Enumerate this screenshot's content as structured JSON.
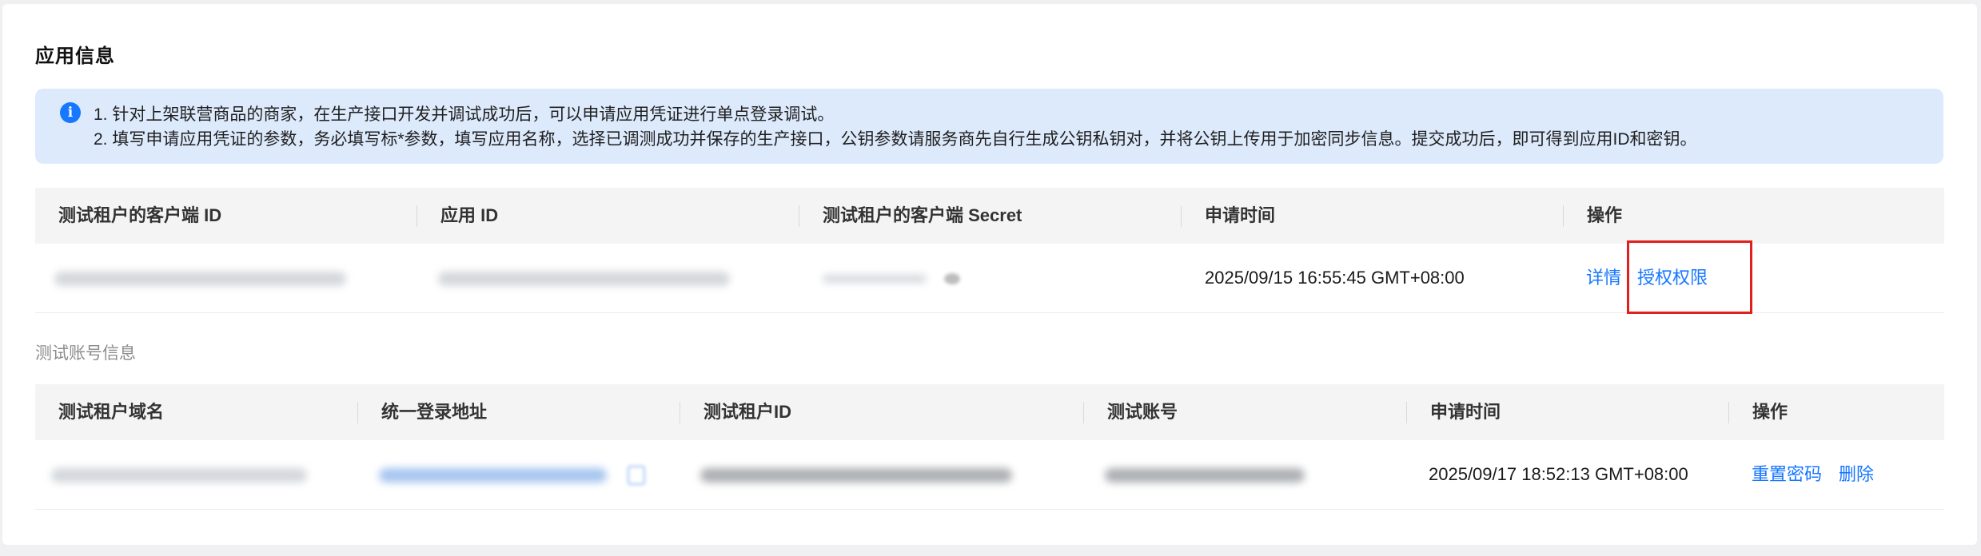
{
  "app_info": {
    "title": "应用信息",
    "notice": {
      "icon": "info-icon",
      "line1": "1. 针对上架联营商品的商家，在生产接口开发并调试成功后，可以申请应用凭证进行单点登录调试。",
      "line2": "2. 填写申请应用凭证的参数，务必填写标*参数，填写应用名称，选择已调测成功并保存的生产接口，公钥参数请服务商先自行生成公钥私钥对，并将公钥上传用于加密同步信息。提交成功后，即可得到应用ID和密钥。"
    },
    "table": {
      "headers": [
        "测试租户的客户端 ID",
        "应用 ID",
        "测试租户的客户端 Secret",
        "申请时间",
        "操作"
      ],
      "rows": [
        {
          "apply_time": "2025/09/15 16:55:45 GMT+08:00",
          "actions": [
            "详情",
            "授权权限"
          ]
        }
      ]
    }
  },
  "test_account": {
    "title": "测试账号信息",
    "table": {
      "headers": [
        "测试租户域名",
        "统一登录地址",
        "测试租户ID",
        "测试账号",
        "申请时间",
        "操作"
      ],
      "rows": [
        {
          "apply_time": "2025/09/17 18:52:13 GMT+08:00",
          "actions": [
            "重置密码",
            "删除"
          ]
        }
      ]
    }
  },
  "colors": {
    "accent": "#1677ff",
    "notice_bg": "#ddeafc",
    "highlight_border": "#e0201c"
  }
}
